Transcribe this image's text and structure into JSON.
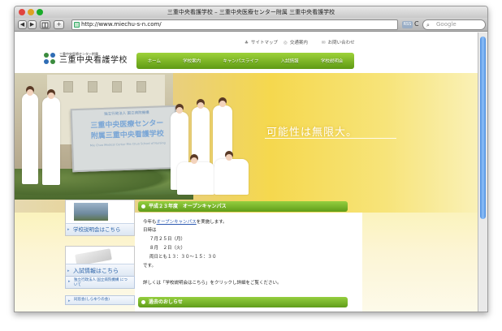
{
  "window": {
    "title": "三重中央看護学校 – 三重中央医療センター附属 三重中央看護学校"
  },
  "toolbar": {
    "back": "◀",
    "forward": "▶",
    "add": "+",
    "address": "http://www.miechu-s-n.com/",
    "rss": "RSS",
    "reload": "C",
    "search_placeholder": "Google"
  },
  "utility_nav": [
    {
      "icon": "sitemap-icon",
      "glyph": "♣",
      "label": "サイトマップ"
    },
    {
      "icon": "access-icon",
      "glyph": "◎",
      "label": "交通案内"
    },
    {
      "icon": "mail-icon",
      "glyph": "✉",
      "label": "お問い合わせ"
    }
  ],
  "logo": {
    "sub": "三重中央医療センター附属",
    "main": "三重中央看護学校"
  },
  "nav": [
    "ホーム",
    "学校案内",
    "キャンパスライフ",
    "入試情報",
    "学校説明会"
  ],
  "hero": {
    "sign_line1": "独立行政法人 国立病院機構",
    "sign_line2": "三重中央医療センター",
    "sign_line3": "附属三重中央看護学校",
    "sign_en": "Mie Chuo Medical Center Mie Chuo School of Nursing",
    "tagline": "可能性は無限大。"
  },
  "sidebar": {
    "info_session": "学校説明会はこちら",
    "admission": "入試情報はこちら",
    "link_hospital": "独立行政法人 国立病院機構 について",
    "link_alumni": "同窓会(しらゆりの会)"
  },
  "open_campus": {
    "heading": "平成２３年度　オープンキャンパス",
    "line1_pre": "今年も",
    "line1_link": "オープンキャンパス",
    "line1_post": "を実施します。",
    "date_label": "日時は",
    "date1": "７月２５日（月）",
    "date2": "８月　２日（火）",
    "time": "両日とも１３：３０～１５：３０",
    "end": "です。",
    "detail": "詳しくは「学校説明会はこちら」をクリックし詳細をご覧ください。"
  },
  "past_news": {
    "heading": "過去のおしらせ"
  }
}
